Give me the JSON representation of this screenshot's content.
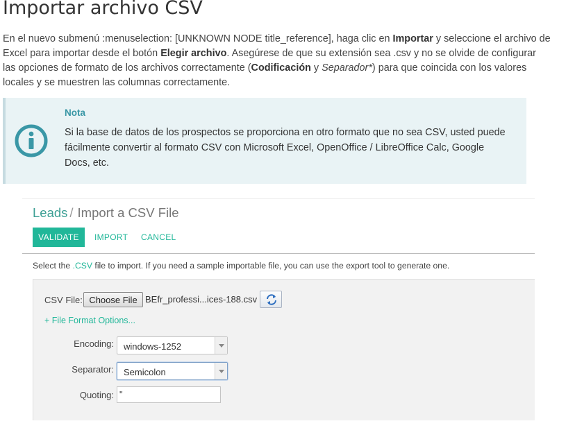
{
  "doc": {
    "title": "Importar archivo CSV",
    "intro_1": "En el nuevo submenú :menuselection: [UNKNOWN NODE title_reference], haga clic en ",
    "intro_b1": "Importar",
    "intro_2": " y seleccione el archivo de Excel para importar desde el botón ",
    "intro_b2": "Elegir archivo",
    "intro_3": ". Asegúrese de que su extensión sea .csv y no se olvide de configurar las opciones de formato de los archivos correctamente (",
    "intro_b3": "Codificación",
    "intro_4": " y ",
    "intro_i1": "Separador*",
    "intro_5": ") para que coincida con los valores locales y se muestren las columnas correctamente."
  },
  "note": {
    "icon": "info-circle-icon",
    "title": "Nota",
    "text": "Si la base de datos de los prospectos se proporciona en otro formato que no sea CSV, usted puede fácilmente convertir al formato CSV con Microsoft Excel, OpenOffice / LibreOffice Calc, Google Docs, etc."
  },
  "app": {
    "breadcrumb_parent": "Leads",
    "breadcrumb_sep": "/",
    "breadcrumb_current": "Import a CSV File",
    "buttons": {
      "validate": "VALIDATE",
      "import": "IMPORT",
      "cancel": "CANCEL"
    },
    "help_1": "Select the ",
    "help_ext": ".CSV",
    "help_2": " file to import. If you need a sample importable file, you can use the export tool to generate one.",
    "form": {
      "csv_label": "CSV File:",
      "choose_file": "Choose File",
      "file_name": "BEfr_professi...ices-188.csv",
      "reload_icon": "reload-icon",
      "format_options": "+ File Format Options...",
      "encoding_label": "Encoding:",
      "encoding_value": "windows-1252",
      "separator_label": "Separator:",
      "separator_value": "Semicolon",
      "quoting_label": "Quoting:",
      "quoting_value": "\""
    }
  },
  "colors": {
    "accent": "#21b799",
    "note_bg": "#e9f3f5",
    "note_title": "#3a97a6",
    "info_icon": "#3a97a6"
  }
}
